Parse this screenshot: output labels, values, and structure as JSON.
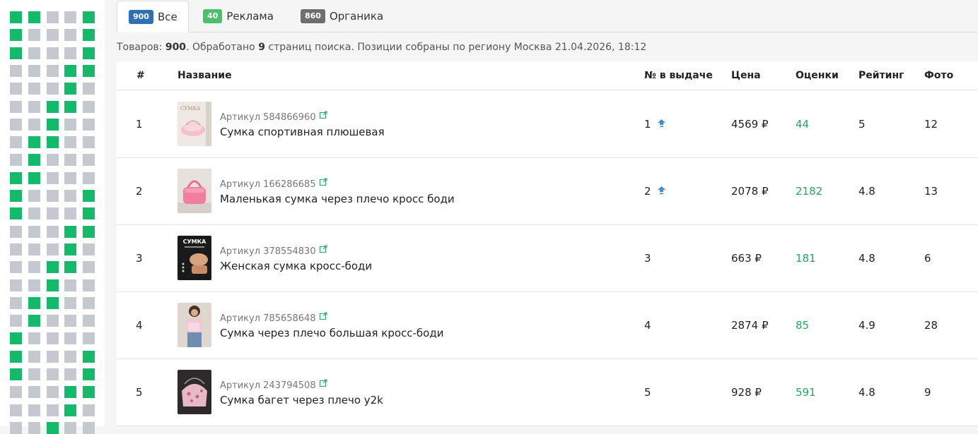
{
  "tabs": [
    {
      "count": "900",
      "label": "Все",
      "color": "#2f6fb6"
    },
    {
      "count": "40",
      "label": "Реклама",
      "color": "#4bbf6b"
    },
    {
      "count": "860",
      "label": "Органика",
      "color": "#6e6e6e"
    }
  ],
  "summary": {
    "p1": "Товаров: ",
    "total": "900",
    "p2": ". Обработано ",
    "pages": "9",
    "p3": " страниц поиска. Позиции собраны по региону Москва 21.04.2026, 18:12"
  },
  "table": {
    "headers": {
      "num": "#",
      "name": "Название",
      "position": "№ в выдаче",
      "price": "Цена",
      "reviews": "Оценки",
      "rating": "Рейтинг",
      "photos": "Фото"
    },
    "rows": [
      {
        "num": "1",
        "article": "Артикул 584866960",
        "name": "Сумка спортивная плюшевая",
        "position": "1",
        "up": true,
        "price": "4569 ₽",
        "reviews": "44",
        "rating": "5",
        "photos": "12",
        "thumb_text": "СУМКА"
      },
      {
        "num": "2",
        "article": "Артикул 166286685",
        "name": "Маленькая сумка через плечо кросс боди",
        "position": "2",
        "up": true,
        "price": "2078 ₽",
        "reviews": "2182",
        "rating": "4.8",
        "photos": "13"
      },
      {
        "num": "3",
        "article": "Артикул 378554830",
        "name": "Женская сумка кросс-боди",
        "position": "3",
        "up": false,
        "price": "663 ₽",
        "reviews": "181",
        "rating": "4.8",
        "photos": "6",
        "thumb_text": "СУМКА"
      },
      {
        "num": "4",
        "article": "Артикул 785658648",
        "name": "Сумка через плечо большая кросс-боди",
        "position": "4",
        "up": false,
        "price": "2874 ₽",
        "reviews": "85",
        "rating": "4.9",
        "photos": "28"
      },
      {
        "num": "5",
        "article": "Артикул 243794508",
        "name": "Сумка багет через плечо y2k",
        "position": "5",
        "up": false,
        "price": "928 ₽",
        "reviews": "591",
        "rating": "4.8",
        "photos": "9"
      }
    ]
  },
  "grid": {
    "green_color": "#15b96a",
    "gray_color": "#c6c8d0",
    "rows": [
      "11001",
      "10001",
      "10001",
      "00011",
      "00010",
      "00110",
      "00100",
      "01100",
      "01000",
      "11000",
      "10001",
      "10001",
      "00011",
      "00010",
      "00110",
      "00100",
      "01100",
      "01000",
      "10000",
      "10001",
      "10001",
      "00011",
      "00010",
      "00100"
    ]
  }
}
